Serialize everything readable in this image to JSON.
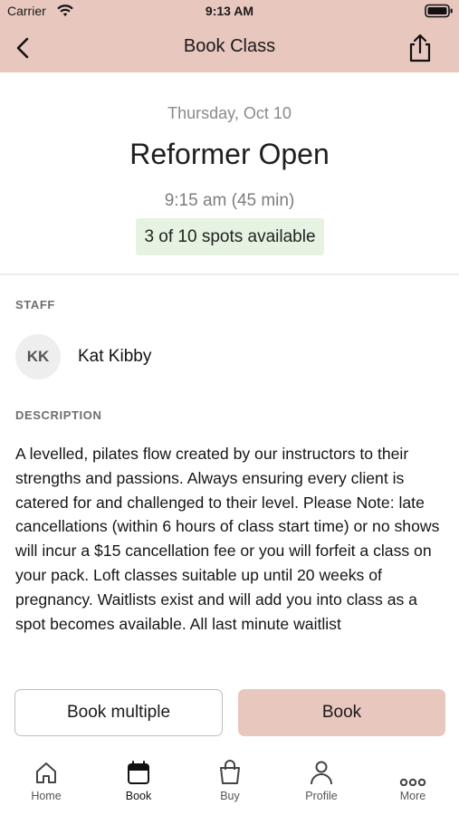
{
  "status_bar": {
    "carrier": "Carrier",
    "time": "9:13 AM"
  },
  "navbar": {
    "title": "Book Class"
  },
  "class_info": {
    "date": "Thursday, Oct 10",
    "name": "Reformer Open",
    "time": "9:15 am (45 min)",
    "spots": "3 of 10 spots available"
  },
  "staff": {
    "section_label": "STAFF",
    "initials": "KK",
    "name": "Kat Kibby"
  },
  "description": {
    "section_label": "DESCRIPTION",
    "text": "A levelled, pilates flow created by our instructors to their strengths and passions. Always ensuring every client is catered for and challenged to their level. Please Note: late cancellations (within 6 hours of class start time) or no shows will incur a $15 cancellation fee or you will forfeit a class on your pack. Loft classes suitable up until 20 weeks of pregnancy. Waitlists exist and will add you into class as a spot becomes available. All last minute waitlist"
  },
  "actions": {
    "book_multiple": "Book multiple",
    "book": "Book"
  },
  "tabs": [
    {
      "label": "Home",
      "icon": "home-icon"
    },
    {
      "label": "Book",
      "icon": "calendar-icon"
    },
    {
      "label": "Buy",
      "icon": "shopping-bag-icon"
    },
    {
      "label": "Profile",
      "icon": "person-icon"
    },
    {
      "label": "More",
      "icon": "more-dots-icon"
    }
  ],
  "colors": {
    "accent": "#e8c7bf",
    "spots_bg": "#e6f2e2"
  }
}
